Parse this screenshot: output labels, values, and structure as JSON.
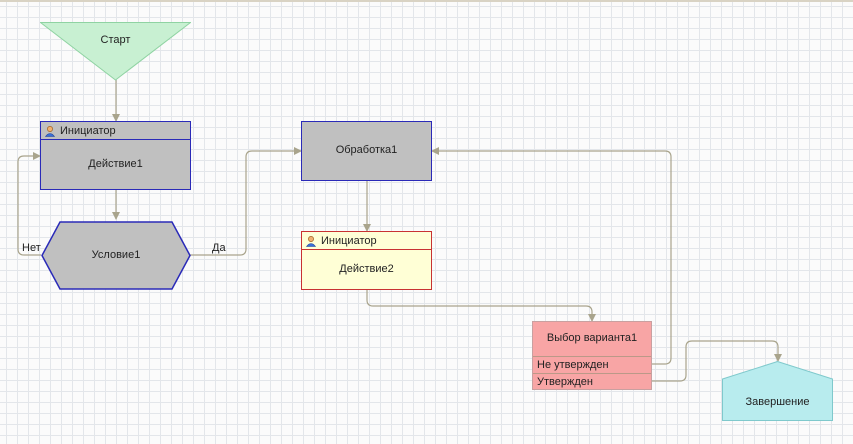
{
  "nodes": {
    "start": {
      "label": "Старт"
    },
    "action1": {
      "role": "Инициатор",
      "label": "Действие1"
    },
    "condition1": {
      "label": "Условие1"
    },
    "processing1": {
      "label": "Обработка1"
    },
    "action2": {
      "role": "Инициатор",
      "label": "Действие2"
    },
    "choice1": {
      "label": "Выбор варианта1",
      "options": [
        "Не утвержден",
        "Утвержден"
      ]
    },
    "end": {
      "label": "Завершение"
    }
  },
  "edge_labels": {
    "no": "Нет",
    "yes": "Да"
  },
  "colors": {
    "grid": "#e3e6ea",
    "connector": "#a9a48c",
    "start_fill": "#c8f0d2",
    "gray_fill": "#c0c0c0",
    "blue_border": "#2a2ab8",
    "yellow_fill": "#ffffd6",
    "red_border": "#c83232",
    "pink_fill": "#f8a5a5",
    "end_fill": "#b8ecee"
  }
}
